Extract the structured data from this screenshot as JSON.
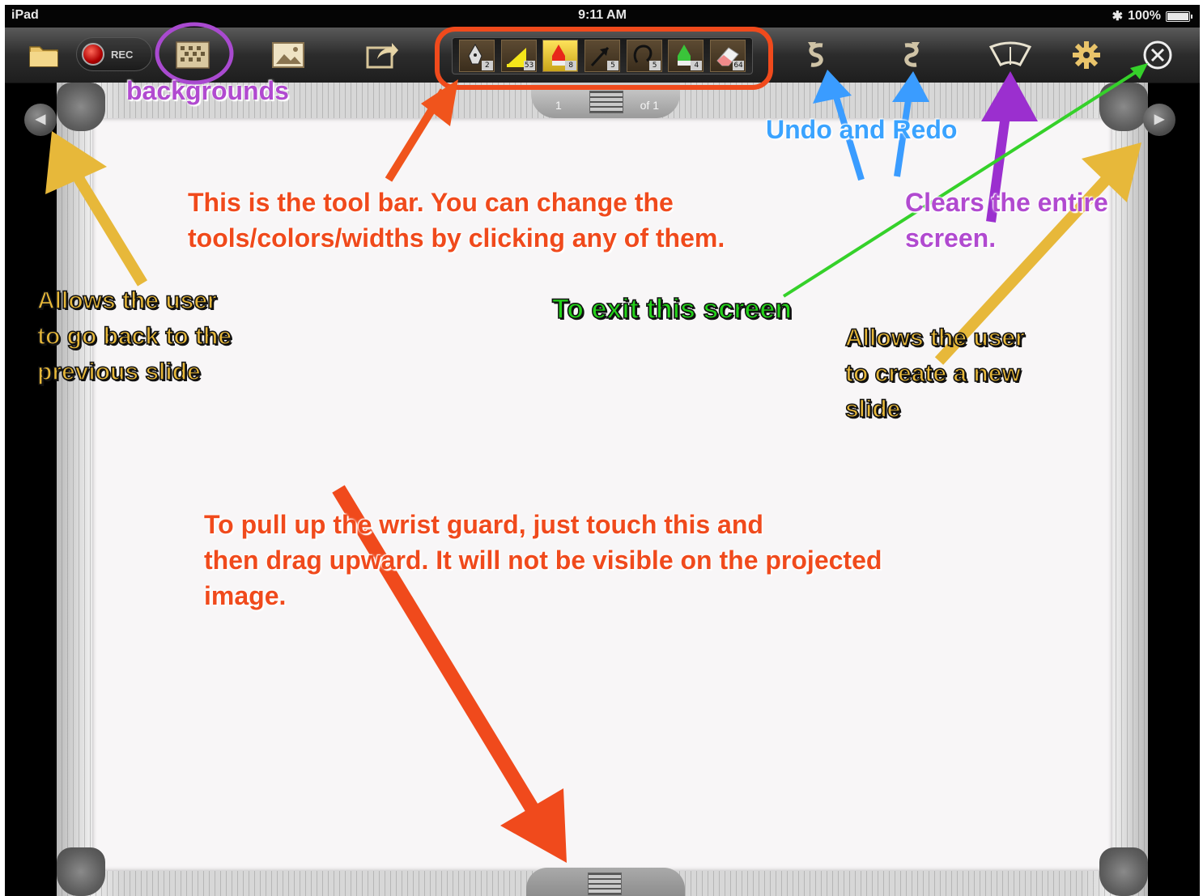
{
  "status_bar": {
    "device": "iPad",
    "time": "9:11 AM",
    "battery": "100%"
  },
  "toolbar": {
    "folder_icon": "folder-icon",
    "record_label": "REC",
    "backgrounds_icon": "backgrounds-icon",
    "image_icon": "image-icon",
    "share_icon": "share-icon",
    "tools": [
      {
        "name": "pen-tool",
        "size": "2"
      },
      {
        "name": "highlighter-tool",
        "size": "53"
      },
      {
        "name": "marker-red-tool",
        "size": "8"
      },
      {
        "name": "arrow-tool",
        "size": "5"
      },
      {
        "name": "lasso-tool",
        "size": "5"
      },
      {
        "name": "marker-green-tool",
        "size": "4"
      },
      {
        "name": "eraser-tool",
        "size": "64"
      }
    ],
    "undo_icon": "undo-icon",
    "redo_icon": "redo-icon",
    "clear_icon": "clear-screen-icon",
    "settings_icon": "gear-icon",
    "close_icon": "close-icon"
  },
  "pager": {
    "current": "1",
    "total": "of 1"
  },
  "annotations": {
    "backgrounds": "backgrounds",
    "toolbar_note": "This is the tool bar.  You can change the\ntools/colors/widths by clicking any of them.",
    "undo_redo": "Undo and Redo",
    "clears": "Clears the entire\nscreen.",
    "back_slide": "Allows the user\nto go back to the\nprevious slide",
    "exit": "To  exit this screen",
    "new_slide": "Allows the user\nto create a new\nslide",
    "wrist_guard": "To pull up the wrist guard, just touch this and\nthen drag upward.  It will not be visible on the projected\nimage."
  },
  "colors": {
    "red_annotation": "#f04a1c",
    "yellow_annotation": "#e7b83a",
    "green_annotation": "#24d31a",
    "blue_annotation": "#3aa3ff",
    "purple_annotation": "#b14ad0"
  }
}
